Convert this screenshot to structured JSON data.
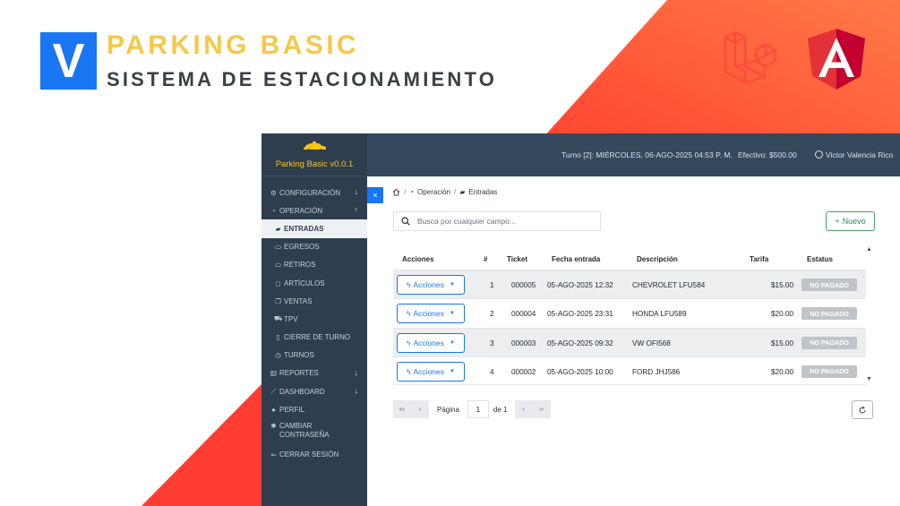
{
  "brand": {
    "logo_letter": "V",
    "title": "PARKING BASIC",
    "subtitle": "SISTEMA DE ESTACIONAMIENTO",
    "colors": {
      "title": "#f6c84a",
      "logo_bg": "#1976f2",
      "accent": "#ff5a3c"
    },
    "tech_logos": [
      "laravel-icon",
      "angular-icon"
    ]
  },
  "sidebar": {
    "app_name": "Parking Basic v0.0.1",
    "items": [
      {
        "label": "CONFIGURACIÓN",
        "icon": "gear-icon",
        "arrow": "↓"
      },
      {
        "label": "OPERACIÓN",
        "icon": "dashboard-icon",
        "arrow": "↑"
      },
      {
        "label": "ENTRADAS",
        "icon": "car-icon",
        "active": true
      },
      {
        "label": "EGRESOS",
        "icon": "money-icon"
      },
      {
        "label": "RETIROS",
        "icon": "money-icon"
      },
      {
        "label": "ARTÍCULOS",
        "icon": "box-icon"
      },
      {
        "label": "VENTAS",
        "icon": "copy-icon"
      },
      {
        "label": "TPV",
        "icon": "cart-icon"
      },
      {
        "label": "CIERRE DE TURNO",
        "icon": "clipboard-icon"
      },
      {
        "label": "TURNOS",
        "icon": "clock-icon"
      },
      {
        "label": "REPORTES",
        "icon": "bar-chart-icon",
        "arrow": "↓"
      },
      {
        "label": "DASHBOARD",
        "icon": "line-chart-icon",
        "arrow": "↓"
      },
      {
        "label": "PERFIL",
        "icon": "user-icon"
      },
      {
        "label": "CAMBIAR CONTRASEÑA",
        "icon": "asterisk-icon"
      },
      {
        "label": "CERRAR SESIÓN",
        "icon": "logout-icon"
      }
    ]
  },
  "topbar": {
    "turno": "Turno [2]: MIÉRCOLES, 06-AGO-2025 04:53 P. M.",
    "efectivo": "Efectivo:  $500.00",
    "user": "Victor Valencia Rico"
  },
  "toggle": {
    "label": "×"
  },
  "breadcrumb": {
    "home_icon": "home-icon",
    "operacion": "Operación",
    "entradas": "Entradas",
    "sep": "/"
  },
  "search": {
    "placeholder": "Busca por cualquier campo..."
  },
  "nuevo": {
    "label": "Nuevo",
    "icon": "+"
  },
  "table": {
    "headers": {
      "acciones": "Acciones",
      "num": "#",
      "ticket": "Ticket",
      "fecha": "Fecha entrada",
      "descripcion": "Descripción",
      "tarifa": "Tarifa",
      "estatus": "Estatus"
    },
    "action_label": "Acciones",
    "rows": [
      {
        "num": "1",
        "ticket": "000005",
        "fecha": "05-AGO-2025 12:32",
        "descripcion": "CHEVROLET LFU584",
        "tarifa": "$15.00",
        "estatus": "NO PAGADO"
      },
      {
        "num": "2",
        "ticket": "000004",
        "fecha": "05-AGO-2025 23:31",
        "descripcion": "HONDA LFU589",
        "tarifa": "$20.00",
        "estatus": "NO PAGADO"
      },
      {
        "num": "3",
        "ticket": "000003",
        "fecha": "05-AGO-2025 09:32",
        "descripcion": "VW OFI568",
        "tarifa": "$15.00",
        "estatus": "NO PAGADO"
      },
      {
        "num": "4",
        "ticket": "000002",
        "fecha": "05-AGO-2025 10:00",
        "descripcion": "FORD JHJ586",
        "tarifa": "$20.00",
        "estatus": "NO PAGADO"
      }
    ]
  },
  "pager": {
    "first": "«‹",
    "prev": "‹",
    "label": "Página",
    "value": "1",
    "of": "de 1",
    "next": "›",
    "last": "››"
  }
}
